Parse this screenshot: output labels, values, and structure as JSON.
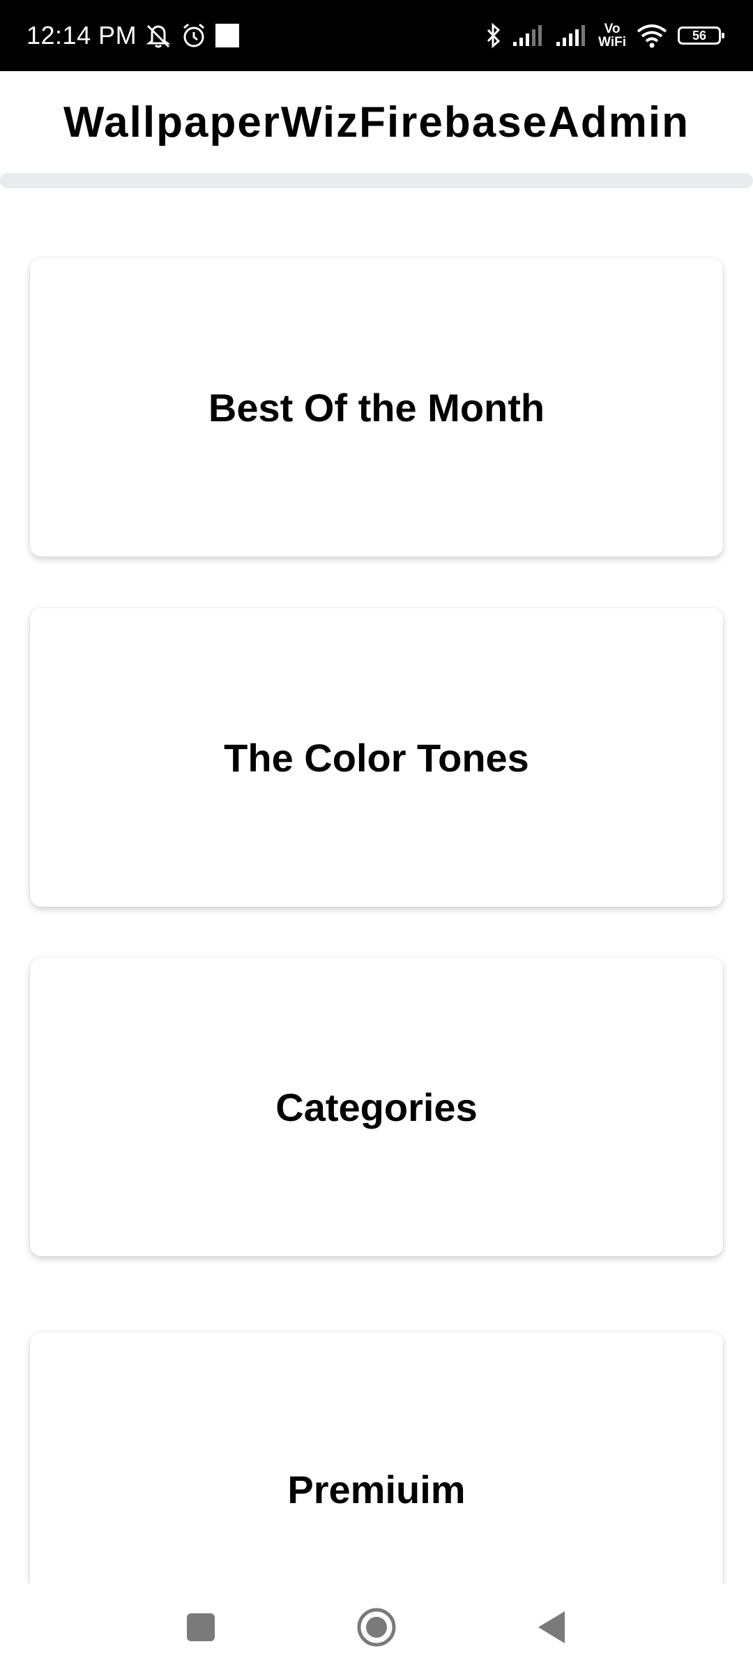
{
  "status_bar": {
    "time": "12:14 PM",
    "icons": [
      "mute-icon",
      "alarm-icon",
      "notification-square-icon",
      "bluetooth-icon",
      "signal-icon",
      "signal-icon",
      "vowifi-icon",
      "wifi-icon",
      "battery-icon"
    ],
    "vowifi_top": "Vo",
    "vowifi_bottom": "WiFi",
    "battery_level": "56"
  },
  "app_bar": {
    "title": "WallpaperWizFirebaseAdmin"
  },
  "menu": {
    "items": [
      {
        "label": "Best Of the Month"
      },
      {
        "label": "The Color Tones"
      },
      {
        "label": "Categories"
      },
      {
        "label": "Premiuim"
      }
    ]
  },
  "nav_bar": {
    "buttons": [
      "recents-icon",
      "home-icon",
      "back-icon"
    ]
  },
  "colors": {
    "status_bar_bg": "#000000",
    "background": "#ffffff",
    "progress_track": "#e9ecee",
    "nav_icon": "#7a7a7a"
  }
}
